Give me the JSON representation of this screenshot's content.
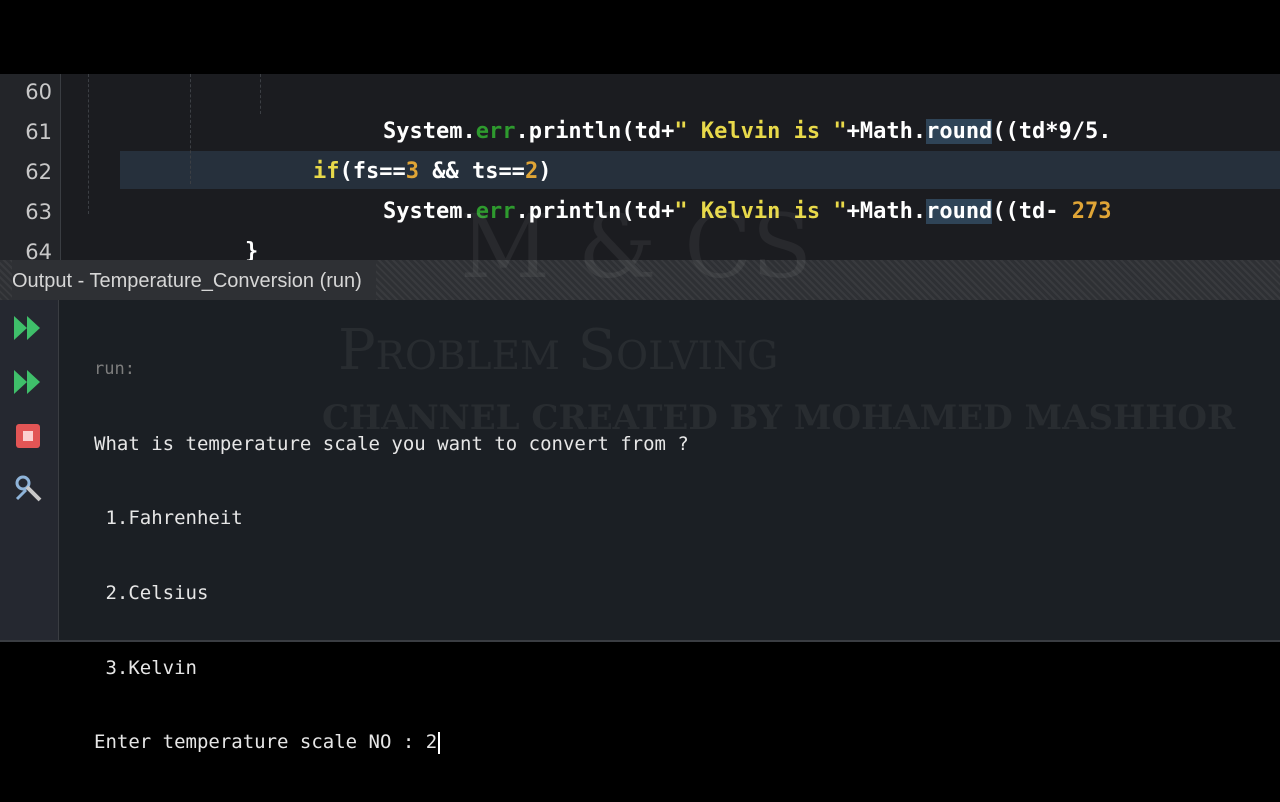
{
  "editor": {
    "lines": [
      {
        "num": "60",
        "indent": "          ",
        "pre": "System.",
        "err": "err",
        "mid": ".println(td+",
        "str": "\" Kelvin is \"",
        "post": "+Math.",
        "method": "round",
        "tail": "((td*9/5."
      },
      {
        "num": "61",
        "indent": "      ",
        "if_kw": "if",
        "cond_a": "(fs==",
        "n1": "3",
        "cond_b": " && ts==",
        "n2": "2",
        "cond_c": ")"
      },
      {
        "num": "62",
        "indent": "          ",
        "pre": "System.",
        "err": "err",
        "mid": ".println(td+",
        "str": "\" Kelvin is \"",
        "post": "+Math.",
        "method": "round",
        "tail": "((td- ",
        "num_tail": "273"
      },
      {
        "num": "63",
        "indent": "     ",
        "brace": "}"
      },
      {
        "num": "64",
        "indent": "  ",
        "brace": "}"
      }
    ]
  },
  "output": {
    "title": "Output - Temperature_Conversion (run)",
    "console": {
      "run": "run:",
      "prompt": "What is temperature scale you want to convert from ?",
      "opt1": " 1.Fahrenheit",
      "opt2": " 2.Celsius",
      "opt3": " 3.Kelvin",
      "input_prompt": "Enter temperature scale NO : ",
      "input_value": "2"
    }
  },
  "toolbar": {
    "icons": [
      "rerun-icon",
      "rerun-with-input-icon",
      "stop-icon",
      "settings-icon"
    ]
  },
  "watermark": {
    "line1": "M & CS",
    "line2": "Problem Solving",
    "line3": "CHANNEL CREATED BY MOHAMED MASHHOR"
  },
  "colors": {
    "editor_bg": "#1b1c20",
    "string": "#e8d94a",
    "err": "#2e9a2e",
    "number": "#e0a536",
    "stop_red": "#e25555",
    "run_green": "#3fbf6a"
  }
}
